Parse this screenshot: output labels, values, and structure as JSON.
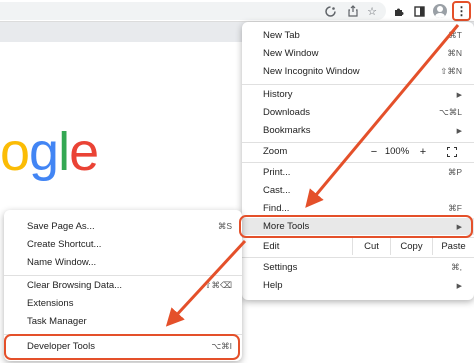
{
  "toolbar": {
    "icons": [
      "google-lens-icon",
      "share-icon",
      "star-icon",
      "extensions-icon",
      "side-panel-icon",
      "profile-icon",
      "more-menu-icon"
    ],
    "menu_glyph": "⋮"
  },
  "logo": [
    "o",
    "g",
    "l",
    "e"
  ],
  "main_menu": {
    "new_tab": {
      "label": "New Tab",
      "shortcut": "⌘T"
    },
    "new_window": {
      "label": "New Window",
      "shortcut": "⌘N"
    },
    "new_incognito": {
      "label": "New Incognito Window",
      "shortcut": "⇧⌘N"
    },
    "history": {
      "label": "History"
    },
    "downloads": {
      "label": "Downloads",
      "shortcut": "⌥⌘L"
    },
    "bookmarks": {
      "label": "Bookmarks"
    },
    "zoom": {
      "label": "Zoom",
      "minus": "−",
      "value": "100%",
      "plus": "+"
    },
    "print": {
      "label": "Print...",
      "shortcut": "⌘P"
    },
    "cast": {
      "label": "Cast..."
    },
    "find": {
      "label": "Find...",
      "shortcut": "⌘F"
    },
    "more_tools": {
      "label": "More Tools"
    },
    "edit": {
      "label": "Edit",
      "cut": "Cut",
      "copy": "Copy",
      "paste": "Paste"
    },
    "settings": {
      "label": "Settings",
      "shortcut": "⌘,"
    },
    "help": {
      "label": "Help"
    }
  },
  "sub_menu": {
    "save_page": {
      "label": "Save Page As...",
      "shortcut": "⌘S"
    },
    "create_shortcut": {
      "label": "Create Shortcut..."
    },
    "name_window": {
      "label": "Name Window..."
    },
    "clear_browsing": {
      "label": "Clear Browsing Data...",
      "shortcut": "⇧⌘⌫"
    },
    "extensions": {
      "label": "Extensions"
    },
    "task_manager": {
      "label": "Task Manager"
    },
    "developer_tools": {
      "label": "Developer Tools",
      "shortcut": "⌥⌘I"
    }
  },
  "colors": {
    "callout": "#e4502a",
    "google_yellow": "#fbbc05",
    "google_blue": "#4285f4",
    "google_green": "#34a853",
    "google_red": "#ea4335"
  }
}
